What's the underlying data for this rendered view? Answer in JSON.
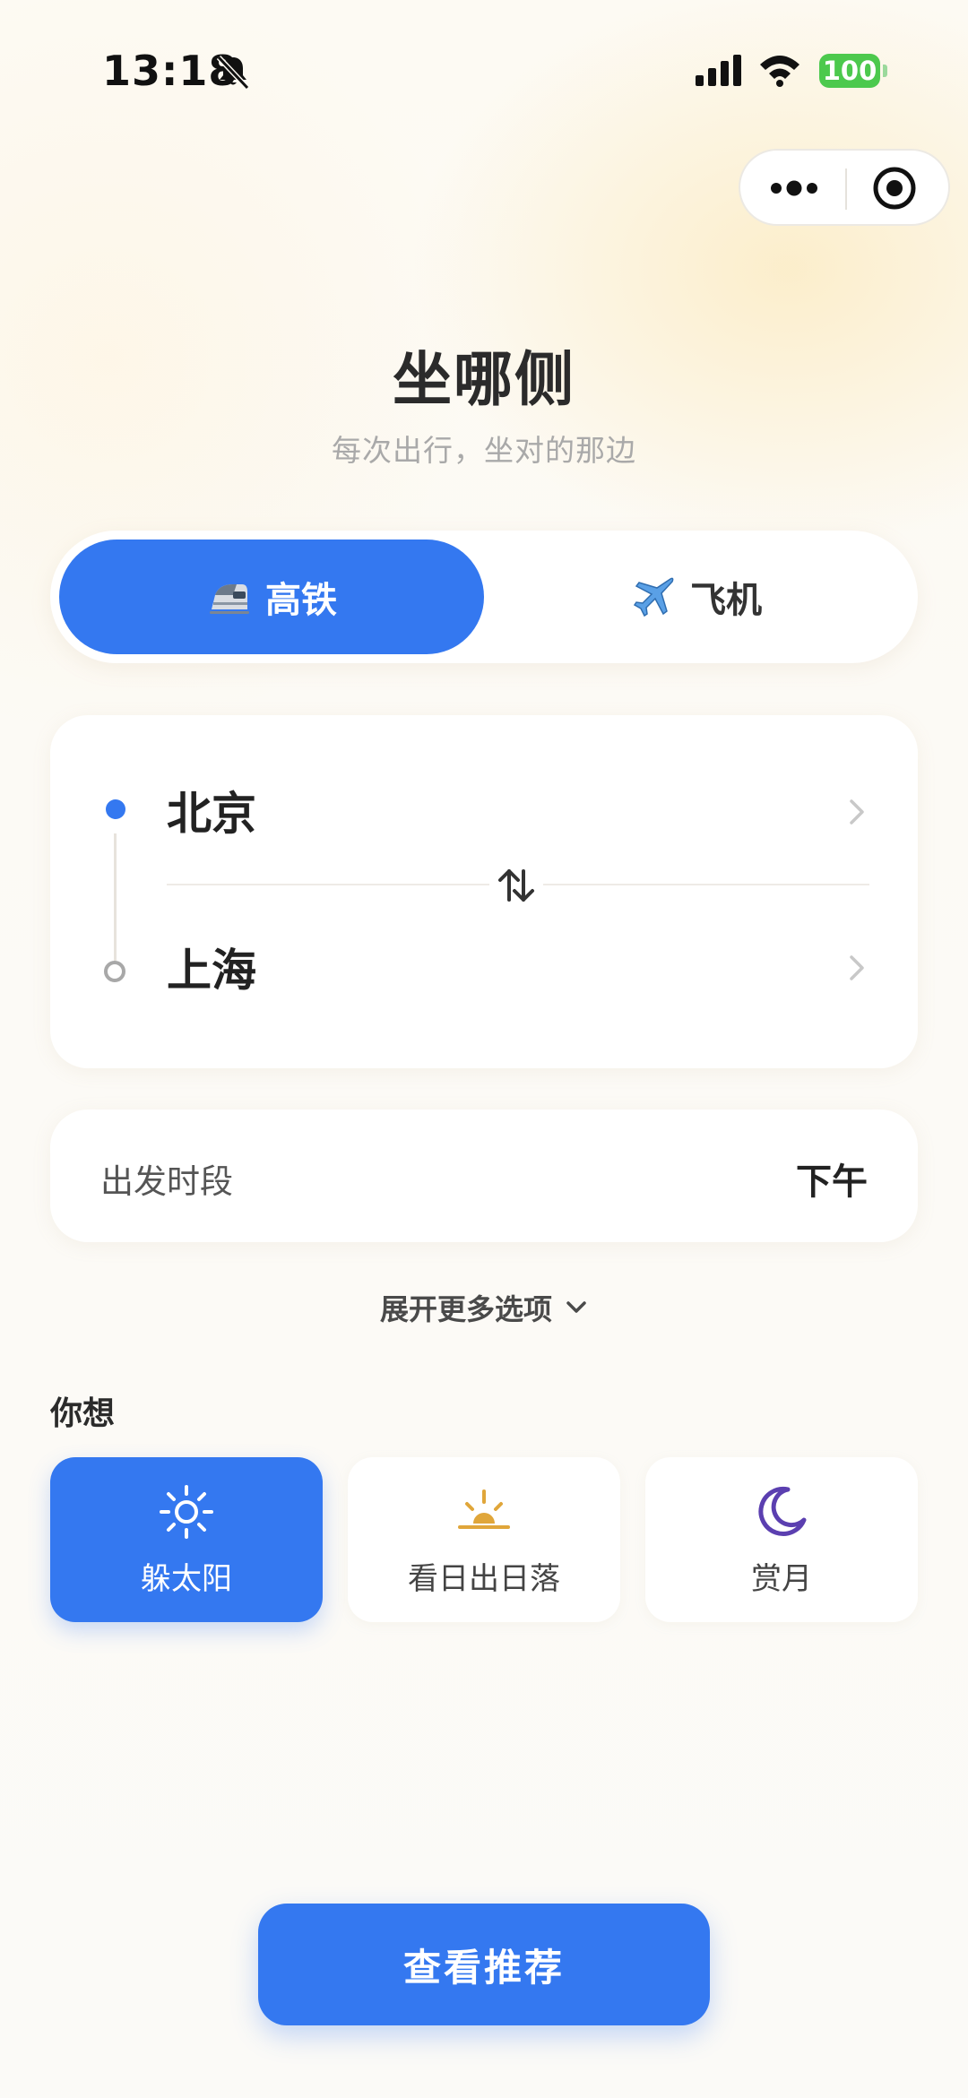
{
  "status_bar": {
    "time": "13:18",
    "battery": "100",
    "icons": [
      "bell-muted-icon",
      "signal-icon",
      "wifi-icon",
      "battery-icon"
    ]
  },
  "capsule": {
    "icons": [
      "more-dots-icon",
      "close-target-icon"
    ]
  },
  "header": {
    "title": "坐哪侧",
    "subtitle": "每次出行，坐对的那边"
  },
  "mode_switch": {
    "selected": "高铁",
    "options": [
      {
        "label": "高铁",
        "icon": "high-speed-train-icon"
      },
      {
        "label": "飞机",
        "icon": "airplane-icon"
      }
    ]
  },
  "route": {
    "from": "北京",
    "to": "上海"
  },
  "depart": {
    "label": "出发时段",
    "value": "下午"
  },
  "expand": {
    "label": "展开更多选项"
  },
  "want": {
    "label": "你想",
    "selected": "躲太阳",
    "options": [
      {
        "label": "躲太阳",
        "icon": "sun-icon"
      },
      {
        "label": "看日出日落",
        "icon": "sunrise-icon"
      },
      {
        "label": "赏月",
        "icon": "moon-icon"
      }
    ]
  },
  "cta": {
    "label": "查看推荐"
  },
  "colors": {
    "accent": "#3478f0",
    "battery": "#4cc94d",
    "sunrise": "#e0a63a",
    "moon": "#5b3fb0"
  }
}
